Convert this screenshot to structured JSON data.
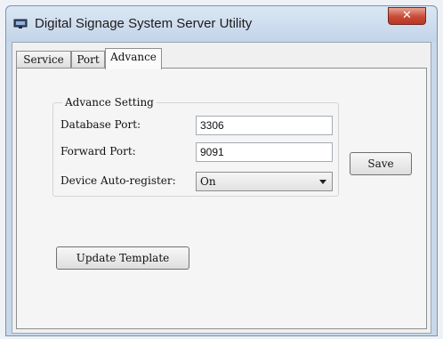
{
  "window": {
    "title": "Digital Signage System Server Utility",
    "close_glyph": "✕",
    "icon": "app-monitor-icon"
  },
  "tabs": [
    {
      "label": "Service",
      "active": false
    },
    {
      "label": "Port",
      "active": false
    },
    {
      "label": "Advance",
      "active": true
    }
  ],
  "advance": {
    "group_title": "Advance Setting",
    "database_port": {
      "label": "Database Port:",
      "value": "3306"
    },
    "forward_port": {
      "label": "Forward Port:",
      "value": "9091"
    },
    "device_auto_register": {
      "label": "Device Auto-register:",
      "selected": "On"
    },
    "save_label": "Save",
    "update_template_label": "Update Template"
  },
  "colors": {
    "titlebar": "#c9d8e9",
    "close_button": "#c84a36"
  }
}
